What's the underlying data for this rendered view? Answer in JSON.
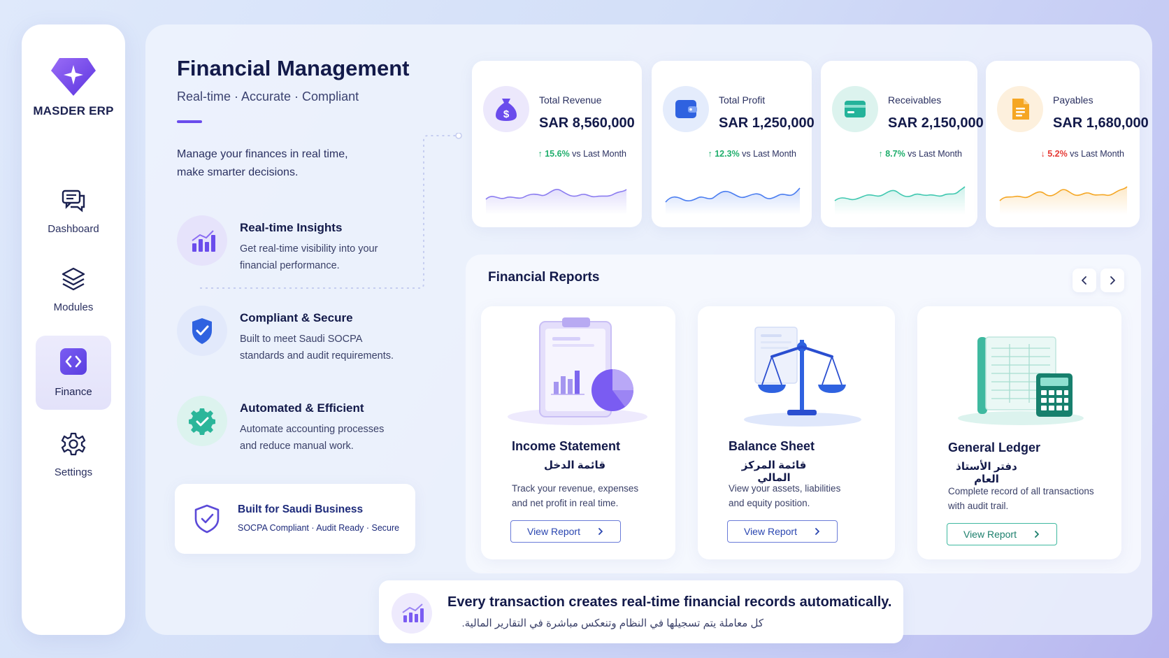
{
  "sidebar": {
    "brand": "MASDER ERP",
    "items": [
      {
        "label": "Dashboard",
        "icon": "chat-bubbles-icon"
      },
      {
        "label": "Modules",
        "icon": "layers-icon"
      },
      {
        "label": "Finance",
        "icon": "code-brackets-icon",
        "active": true
      },
      {
        "label": "Settings",
        "icon": "gear-icon"
      }
    ]
  },
  "header": {
    "title": "Financial Management",
    "subtitle": "Real-time · Accurate · Compliant",
    "intro_line1": "Manage your finances in real time,",
    "intro_line2": "make smarter decisions."
  },
  "features": [
    {
      "title": "Real-time Insights",
      "desc_line1": "Get real-time visibility into your",
      "desc_line2": "financial performance.",
      "icon": "bar-chart-icon"
    },
    {
      "title": "Compliant & Secure",
      "desc_line1": "Built to meet Saudi SOCPA",
      "desc_line2": "standards and audit requirements.",
      "icon": "shield-check-icon"
    },
    {
      "title": "Automated & Efficient",
      "desc_line1": "Automate accounting processes",
      "desc_line2": "and reduce manual work.",
      "icon": "gear-check-icon"
    }
  ],
  "saudi_card": {
    "title": "Built for Saudi Business",
    "subtitle": "SOCPA Compliant · Audit Ready · Secure"
  },
  "kpis": [
    {
      "label": "Total Revenue",
      "value": "SAR 8,560,000",
      "change": "15.6%",
      "change_suffix": "vs Last Month",
      "direction": "up",
      "icon": "money-bag-icon",
      "color": "#8b7cf0"
    },
    {
      "label": "Total Profit",
      "value": "SAR 1,250,000",
      "change": "12.3%",
      "change_suffix": "vs Last Month",
      "direction": "up",
      "icon": "wallet-icon",
      "color": "#4a7df0"
    },
    {
      "label": "Receivables",
      "value": "SAR 2,150,000",
      "change": "8.7%",
      "change_suffix": "vs Last Month",
      "direction": "up",
      "icon": "card-icon",
      "color": "#40c8b0"
    },
    {
      "label": "Payables",
      "value": "SAR 1,680,000",
      "change": "5.2%",
      "change_suffix": "vs Last Month",
      "direction": "down",
      "icon": "document-icon",
      "color": "#f5a623"
    }
  ],
  "reports": {
    "heading": "Financial Reports",
    "cards": [
      {
        "title": "Income Statement",
        "arabic": "قائمة الدخل",
        "desc_line1": "Track your revenue, expenses",
        "desc_line2": "and net profit in real time.",
        "button": "View Report"
      },
      {
        "title": "Balance Sheet",
        "arabic": "قائمة المركز المالي",
        "desc_line1": "View your assets, liabilities",
        "desc_line2": "and equity position.",
        "button": "View Report"
      },
      {
        "title": "General Ledger",
        "arabic": "دفتر الأستاذ العام",
        "desc_line1": "Complete record of all transactions",
        "desc_line2": "with audit trail.",
        "button": "View Report"
      }
    ]
  },
  "banner": {
    "text": "Every transaction creates real-time financial records automatically.",
    "arabic": "كل معاملة يتم تسجيلها في النظام وتنعكس مباشرة في التقارير المالية."
  },
  "colors": {
    "accent": "#6a4cec",
    "up": "#1fae6c",
    "down": "#e53935",
    "navy": "#131a4a"
  }
}
